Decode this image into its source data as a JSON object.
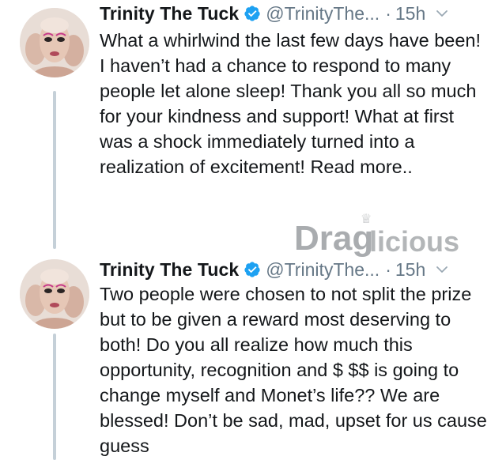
{
  "tweets": [
    {
      "display_name": "Trinity The Tuck",
      "handle": "@TrinityThe...",
      "dot": "·",
      "time": "15h",
      "text": "What a whirlwind the last few days have been! I haven’t had a chance to respond to many people let alone sleep! Thank you all so much for your kindness and support! What at first was a shock immediately turned into a realization of excitement! Read more..",
      "verified": true
    },
    {
      "display_name": "Trinity The Tuck",
      "handle": "@TrinityThe...",
      "dot": "·",
      "time": "15h",
      "text": "Two people were chosen to not split the prize but to be given a reward most deserving to both! Do you all realize how much this opportunity, recognition and $ $$ is going to change myself and Monet’s life?? We are blessed! Don’t be sad, mad, upset for us cause guess",
      "verified": true
    }
  ],
  "watermark": {
    "text_main": "Drag",
    "text_script": "licious",
    "gem": "♕"
  },
  "colors": {
    "thread_line": "#c5d0d8",
    "verified": "#1da1f2",
    "secondary_text": "#657786",
    "watermark": "#b0b3b5"
  },
  "icons": {
    "verified": "verified-badge-icon",
    "menu": "chevron-down-icon",
    "avatar": "avatar"
  }
}
